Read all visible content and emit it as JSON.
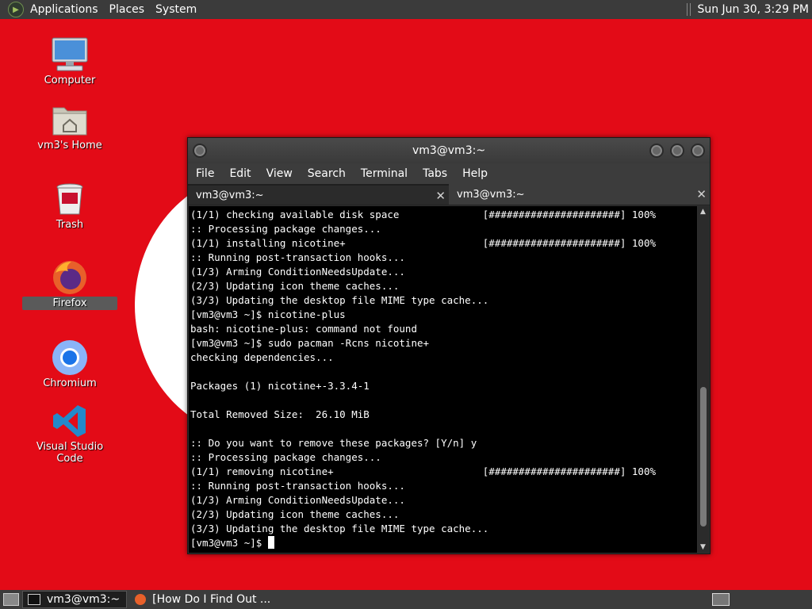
{
  "top_panel": {
    "menus": [
      "Applications",
      "Places",
      "System"
    ],
    "clock": "Sun Jun 30,  3:29 PM"
  },
  "desktop_icons": [
    {
      "label": "Computer",
      "icon": "computer-icon"
    },
    {
      "label": "vm3's Home",
      "icon": "home-folder-icon"
    },
    {
      "label": "Trash",
      "icon": "trash-icon"
    },
    {
      "label": "Firefox",
      "icon": "firefox-icon"
    },
    {
      "label": "Chromium",
      "icon": "chromium-icon"
    },
    {
      "label": "Visual Studio Code",
      "icon": "vscode-icon"
    }
  ],
  "terminal": {
    "title": "vm3@vm3:~",
    "menu": [
      "File",
      "Edit",
      "View",
      "Search",
      "Terminal",
      "Tabs",
      "Help"
    ],
    "tabs": [
      "vm3@vm3:~",
      "vm3@vm3:~"
    ],
    "lines": [
      "(1/1) checking available disk space              [######################] 100%",
      ":: Processing package changes...",
      "(1/1) installing nicotine+                       [######################] 100%",
      ":: Running post-transaction hooks...",
      "(1/3) Arming ConditionNeedsUpdate...",
      "(2/3) Updating icon theme caches...",
      "(3/3) Updating the desktop file MIME type cache...",
      "[vm3@vm3 ~]$ nicotine-plus",
      "bash: nicotine-plus: command not found",
      "[vm3@vm3 ~]$ sudo pacman -Rcns nicotine+",
      "checking dependencies...",
      "",
      "Packages (1) nicotine+-3.3.4-1",
      "",
      "Total Removed Size:  26.10 MiB",
      "",
      ":: Do you want to remove these packages? [Y/n] y",
      ":: Processing package changes...",
      "(1/1) removing nicotine+                         [######################] 100%",
      ":: Running post-transaction hooks...",
      "(1/3) Arming ConditionNeedsUpdate...",
      "(2/3) Updating icon theme caches...",
      "(3/3) Updating the desktop file MIME type cache..."
    ],
    "prompt": "[vm3@vm3 ~]$ "
  },
  "bottom_panel": {
    "tasks": [
      "vm3@vm3:~",
      "[How Do I Find Out ..."
    ]
  },
  "colors": {
    "desktop_background": "#e30b17",
    "panel": "#3b3b3b",
    "terminal_background": "#000000"
  }
}
